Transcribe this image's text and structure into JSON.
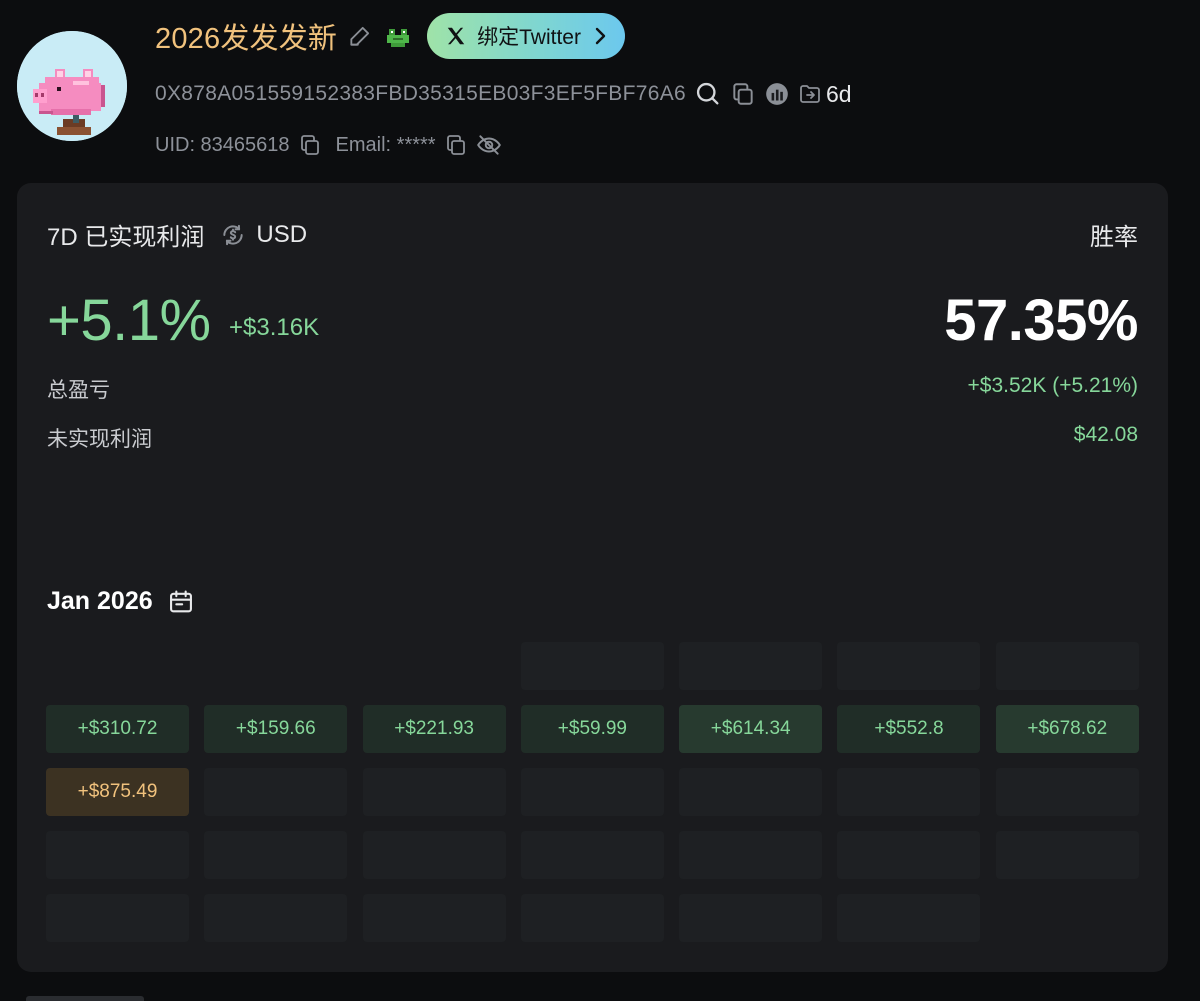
{
  "profile": {
    "username": "2026发发发新",
    "twitter_button_label": "绑定Twitter",
    "address": "0X878A051559152383FBD35315EB03F3EF5FBF76A6",
    "wallet_age": "6d",
    "uid": "UID: 83465618",
    "email": "Email: *****"
  },
  "summary": {
    "period_label": "7D 已实现利润",
    "currency": "USD",
    "realized_pct": "+5.1%",
    "realized_amount": "+$3.16K",
    "winrate_label": "胜率",
    "winrate_value": "57.35%",
    "total_pnl_label": "总盈亏",
    "total_pnl_value": "+$3.52K (+5.21%)",
    "unrealized_label": "未实现利润",
    "unrealized_value": "$42.08"
  },
  "calendar": {
    "month_label": "Jan 2026",
    "days": [
      {
        "kind": "blank",
        "label": ""
      },
      {
        "kind": "blank",
        "label": ""
      },
      {
        "kind": "blank",
        "label": ""
      },
      {
        "kind": "future",
        "label": ""
      },
      {
        "kind": "future",
        "label": ""
      },
      {
        "kind": "future",
        "label": ""
      },
      {
        "kind": "future",
        "label": ""
      },
      {
        "kind": "gain",
        "label": "+$310.72"
      },
      {
        "kind": "gain",
        "label": "+$159.66"
      },
      {
        "kind": "gain",
        "label": "+$221.93"
      },
      {
        "kind": "gain",
        "label": "+$59.99"
      },
      {
        "kind": "gain-strong",
        "label": "+$614.34"
      },
      {
        "kind": "gain",
        "label": "+$552.8"
      },
      {
        "kind": "gain-strong",
        "label": "+$678.62"
      },
      {
        "kind": "top",
        "label": "+$875.49"
      },
      {
        "kind": "future",
        "label": ""
      },
      {
        "kind": "future",
        "label": ""
      },
      {
        "kind": "future",
        "label": ""
      },
      {
        "kind": "future",
        "label": ""
      },
      {
        "kind": "future",
        "label": ""
      },
      {
        "kind": "future",
        "label": ""
      },
      {
        "kind": "future",
        "label": ""
      },
      {
        "kind": "future",
        "label": ""
      },
      {
        "kind": "future",
        "label": ""
      },
      {
        "kind": "future",
        "label": ""
      },
      {
        "kind": "future",
        "label": ""
      },
      {
        "kind": "future",
        "label": ""
      },
      {
        "kind": "future",
        "label": ""
      },
      {
        "kind": "future",
        "label": ""
      },
      {
        "kind": "future",
        "label": ""
      },
      {
        "kind": "future",
        "label": ""
      },
      {
        "kind": "future",
        "label": ""
      },
      {
        "kind": "future",
        "label": ""
      },
      {
        "kind": "future",
        "label": ""
      }
    ]
  },
  "colors": {
    "positive": "#86d79a",
    "username": "#f1c27d",
    "card_background": "#1a1b1e",
    "page_background": "#0c0d0f"
  },
  "icons": {
    "edit": "pencil-icon",
    "frog": "frog-emoji-icon",
    "twitter": "x-logo-icon",
    "search": "search-icon",
    "copy": "copy-icon",
    "explorer": "explorer-icon",
    "wallet_age": "wallet-age-icon",
    "hide": "eye-off-icon",
    "currency": "currency-swap-icon",
    "calendar": "calendar-icon"
  }
}
